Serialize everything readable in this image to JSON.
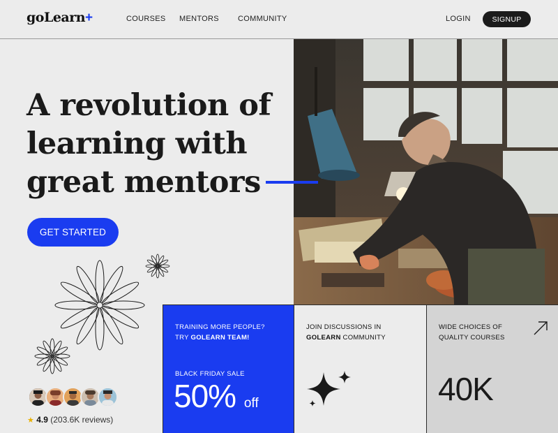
{
  "brand": {
    "name": "goLearn",
    "plus": "+"
  },
  "nav": {
    "courses": "COURSES",
    "mentors": "MENTORS",
    "community": "COMMUNITY",
    "login": "LOGIN",
    "signup": "SIGNUP"
  },
  "hero": {
    "line1": "A revolution of",
    "line2": "learning with",
    "line3": "great mentors",
    "cta": "GET STARTED"
  },
  "social_proof": {
    "star": "★",
    "score": "4.9",
    "reviews": "(203.6K reviews)"
  },
  "cards": {
    "team": {
      "line1": "TRAINING MORE PEOPLE?",
      "line2_prefix": "TRY ",
      "line2_bold": "GOLEARN TEAM!",
      "sale_label": "BLACK FRIDAY SALE",
      "sale_value": "50%",
      "sale_suffix": "off"
    },
    "community": {
      "line1": "JOIN DISCUSSIONS IN",
      "line2_bold": "GOLEARN",
      "line2_suffix": " COMMUNITY"
    },
    "courses": {
      "line1": "WIDE CHOICES OF",
      "line2": "QUALITY COURSES",
      "count": "40K"
    }
  },
  "colors": {
    "accent": "#1a3cf0",
    "background": "#ececec",
    "dark": "#1b1b1b"
  },
  "icons": [
    "sparkle-icon",
    "arrow-up-right-icon",
    "star-icon"
  ]
}
